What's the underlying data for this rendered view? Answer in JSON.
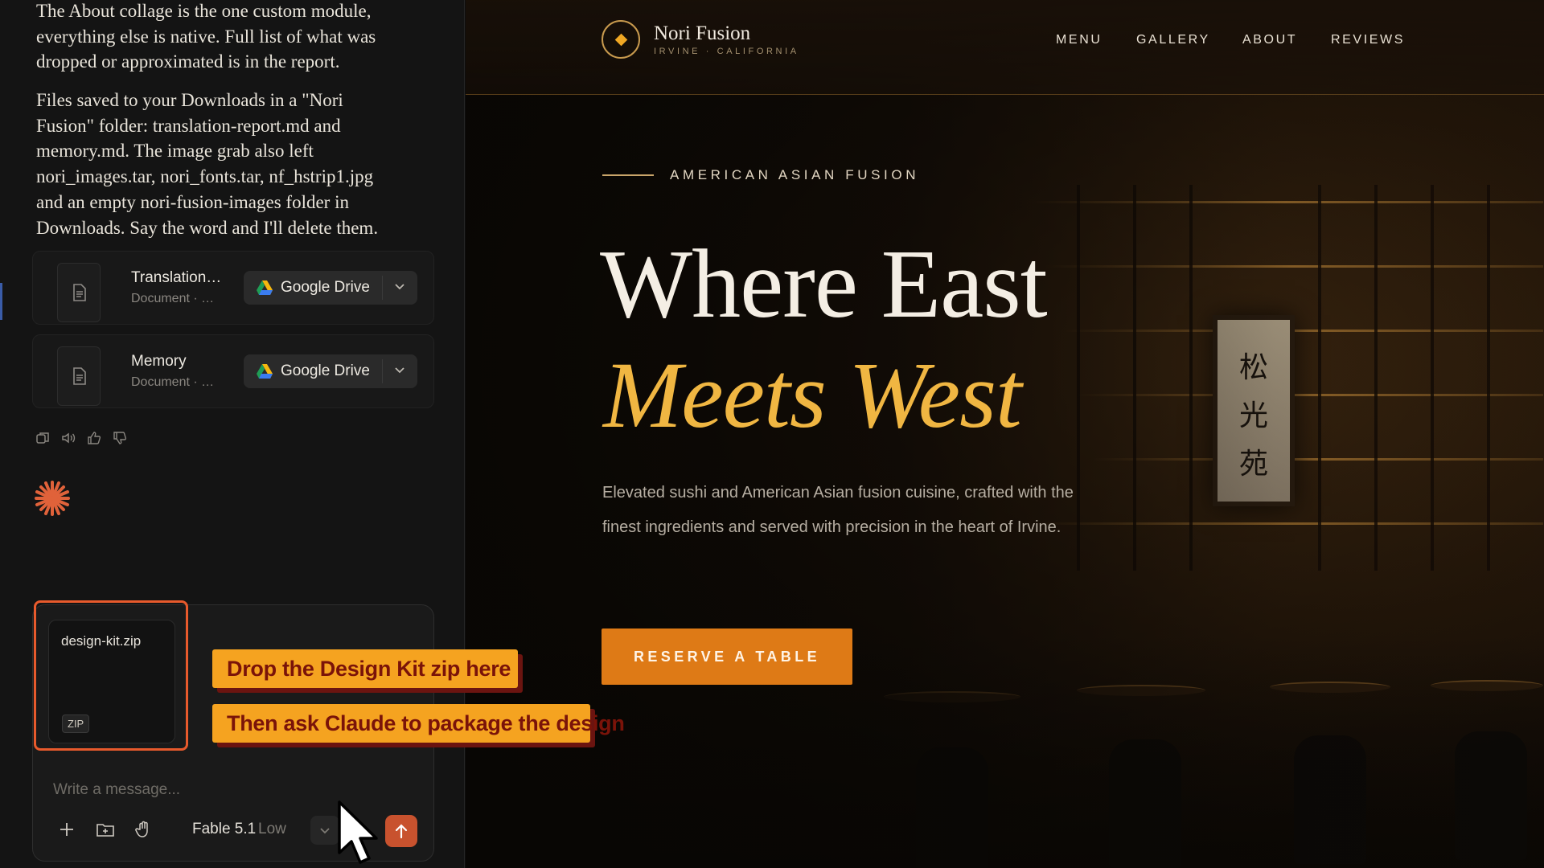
{
  "chat": {
    "paragraph_1": "The About collage is the one custom module, everything else is native. Full list of what was dropped or approximated is in the report.",
    "paragraph_2": "Files saved to your Downloads in a \"Nori Fusion\" folder: translation-report.md and memory.md. The image grab also left nori_images.tar, nori_fonts.tar, nf_hstrip1.jpg and an empty nori-fusion-images folder in Downloads. Say the word and I'll delete them.",
    "files": [
      {
        "name": "Translation…",
        "type": "Document · …",
        "action": "Google Drive"
      },
      {
        "name": "Memory",
        "type": "Document · …",
        "action": "Google Drive"
      }
    ],
    "message_actions": [
      "copy-icon",
      "speaker-icon",
      "thumbs-up-icon",
      "thumbs-down-icon"
    ]
  },
  "composer": {
    "attachment": {
      "name": "design-kit.zip",
      "badge": "ZIP"
    },
    "placeholder": "Write a message...",
    "model": "Fable 5.1",
    "effort": "Low",
    "send_color": "#c8522e"
  },
  "annotations": {
    "banner_1": "Drop the Design Kit zip here",
    "banner_2": "Then ask Claude to package the design",
    "highlight_color": "#e85a2c",
    "banner_color": "#f5a320"
  },
  "site": {
    "brand": "Nori Fusion",
    "brand_sub": "IRVINE · CALIFORNIA",
    "nav": [
      "MENU",
      "GALLERY",
      "ABOUT",
      "REVIEWS"
    ],
    "eyebrow": "AMERICAN ASIAN FUSION",
    "hero_line1": "Where East",
    "hero_line2": "Meets West",
    "description": "Elevated sushi and American Asian fusion cuisine, crafted with the finest ingredients and served with precision in the heart of Irvine.",
    "cta": "RESERVE A TABLE",
    "accent": "#de7a16",
    "gold": "#f0b642"
  }
}
